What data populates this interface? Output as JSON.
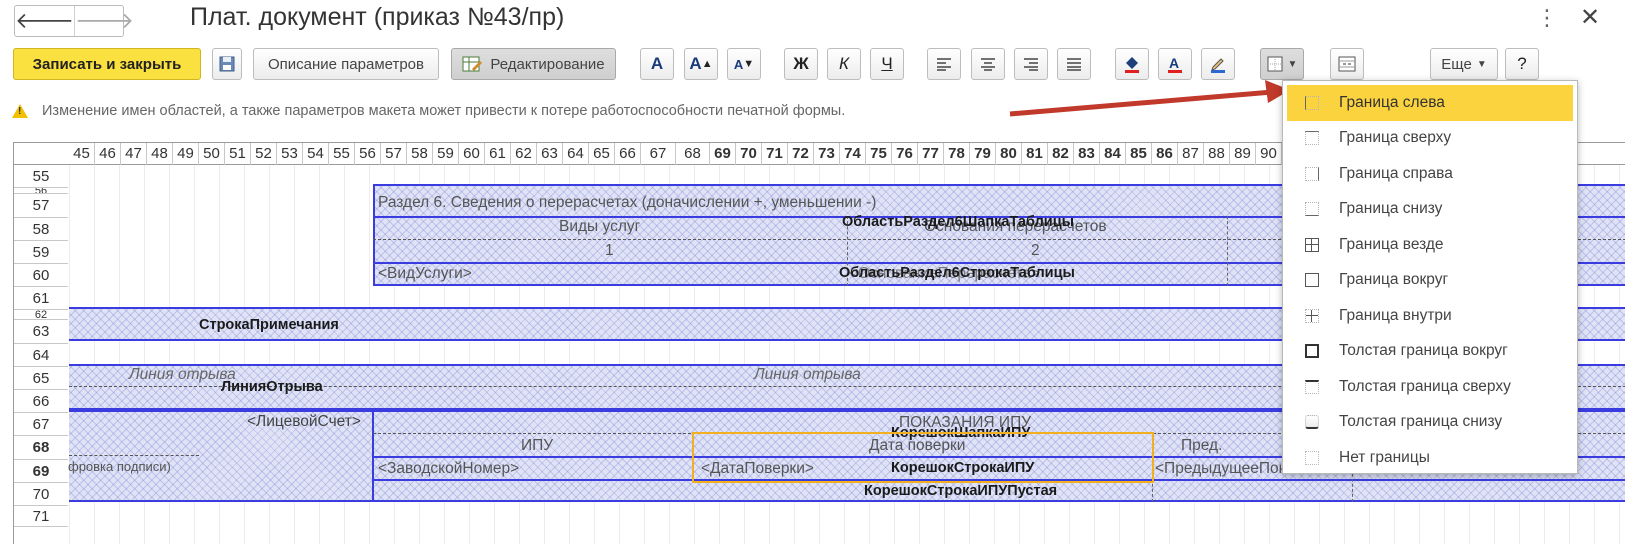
{
  "window": {
    "title": "Плат. документ (приказ №43/пр)",
    "back_icon": "arrow-left-icon",
    "forward_icon": "arrow-right-icon",
    "more_icon": "more-vertical-icon",
    "close_icon": "close-icon"
  },
  "toolbar": {
    "save_close": "Записать и закрыть",
    "params": "Описание параметров",
    "edit": "Редактирование",
    "font_normal": "A",
    "font_bigger": "A",
    "font_smaller": "A",
    "bold": "Ж",
    "italic": "К",
    "underline": "Ч",
    "more": "Еще",
    "help": "?"
  },
  "warning": {
    "text": "Изменение имен областей, а также параметров макета может привести к потере работоспособности печатной формы."
  },
  "sheet": {
    "columns": [
      {
        "label": "45"
      },
      {
        "label": "46"
      },
      {
        "label": "47"
      },
      {
        "label": "48"
      },
      {
        "label": "49"
      },
      {
        "label": "50"
      },
      {
        "label": "51"
      },
      {
        "label": "52"
      },
      {
        "label": "53"
      },
      {
        "label": "54"
      },
      {
        "label": "55"
      },
      {
        "label": "56"
      },
      {
        "label": "57"
      },
      {
        "label": "58"
      },
      {
        "label": "59"
      },
      {
        "label": "60"
      },
      {
        "label": "61"
      },
      {
        "label": "62"
      },
      {
        "label": "63"
      },
      {
        "label": "64"
      },
      {
        "label": "65"
      },
      {
        "label": "66"
      },
      {
        "label": "67"
      },
      {
        "label": "68"
      },
      {
        "label": "69"
      },
      {
        "label": "70"
      },
      {
        "label": "71"
      },
      {
        "label": "72"
      },
      {
        "label": "73"
      },
      {
        "label": "74"
      },
      {
        "label": "75"
      },
      {
        "label": "76"
      },
      {
        "label": "77"
      },
      {
        "label": "78"
      },
      {
        "label": "79"
      },
      {
        "label": "80"
      },
      {
        "label": "81"
      },
      {
        "label": "82"
      },
      {
        "label": "83"
      },
      {
        "label": "84"
      },
      {
        "label": "85"
      },
      {
        "label": "86"
      },
      {
        "label": "87"
      },
      {
        "label": "88"
      },
      {
        "label": "89"
      },
      {
        "label": "90"
      }
    ],
    "rows": [
      {
        "label": "55"
      },
      {
        "label": "56"
      },
      {
        "label": "57"
      },
      {
        "label": "58"
      },
      {
        "label": "59"
      },
      {
        "label": "60"
      },
      {
        "label": "61"
      },
      {
        "label": "62"
      },
      {
        "label": "63"
      },
      {
        "label": "64"
      },
      {
        "label": "65"
      },
      {
        "label": "66"
      },
      {
        "label": "67"
      },
      {
        "label": "68"
      },
      {
        "label": "69"
      },
      {
        "label": "70"
      },
      {
        "label": "71"
      }
    ],
    "cells": {
      "section6": "Раздел 6.     Сведения о перерасчетах (доначислении +, уменьшении -)",
      "vidy_uslug": "Виды услуг",
      "osnovaniya": "Основания перерасчетов",
      "num1": "1",
      "num2": "2",
      "vid_uslugi": "<ВидУслуги>",
      "osnovanie": "<ОснованиеПерерасчета>",
      "liniya_otryva_1": "Линия отрыва",
      "liniya_otryva_2": "Линия отрыва",
      "licevoy_schet": "<ЛицевойСчет>",
      "pokazaniya": "ПОКАЗАНИЯ ИПУ",
      "ipu": "ИПУ",
      "data_poverki": "Дата поверки",
      "pred": "Пред.",
      "podpis": "фровка подписи)",
      "zavodskoy": "<ЗаводскойНомер>",
      "data_poverki_field": "<ДатаПоверки>",
      "predydushee": "<ПредыдущееПоказание>"
    },
    "areas": {
      "razdel6_shapka": "ОбластьРаздел6ШапкаТаблицы",
      "razdel6_stroka": "ОбластьРаздел6СтрокаТаблицы",
      "stroka_primechaniya": "СтрокаПримечания",
      "liniya_otryva": "ЛинияОтрыва",
      "koreshok_shapka": "КорешокШапкаИПУ",
      "koreshok_stroka": "КорешокСтрокаИПУ",
      "koreshok_pustaya": "КорешокСтрокаИПУПустая"
    }
  },
  "border_menu": {
    "items": [
      {
        "label": "Граница слева",
        "icon": "border-left-icon",
        "active": true
      },
      {
        "label": "Граница сверху",
        "icon": "border-top-icon",
        "active": false
      },
      {
        "label": "Граница справа",
        "icon": "border-right-icon",
        "active": false
      },
      {
        "label": "Граница снизу",
        "icon": "border-bottom-icon",
        "active": false
      },
      {
        "label": "Граница везде",
        "icon": "border-all-icon",
        "active": false
      },
      {
        "label": "Граница вокруг",
        "icon": "border-outer-icon",
        "active": false
      },
      {
        "label": "Граница внутри",
        "icon": "border-inner-icon",
        "active": false
      },
      {
        "label": "Толстая граница вокруг",
        "icon": "thick-border-outer-icon",
        "active": false
      },
      {
        "label": "Толстая граница сверху",
        "icon": "thick-border-top-icon",
        "active": false
      },
      {
        "label": "Толстая граница снизу",
        "icon": "thick-border-bottom-icon",
        "active": false
      },
      {
        "label": "Нет границы",
        "icon": "no-border-icon",
        "active": false
      }
    ]
  },
  "colors": {
    "accent": "#fbe13f",
    "area_border": "#3a3ce0",
    "arrow": "#c0392b",
    "highlight": "#fbd33e"
  }
}
